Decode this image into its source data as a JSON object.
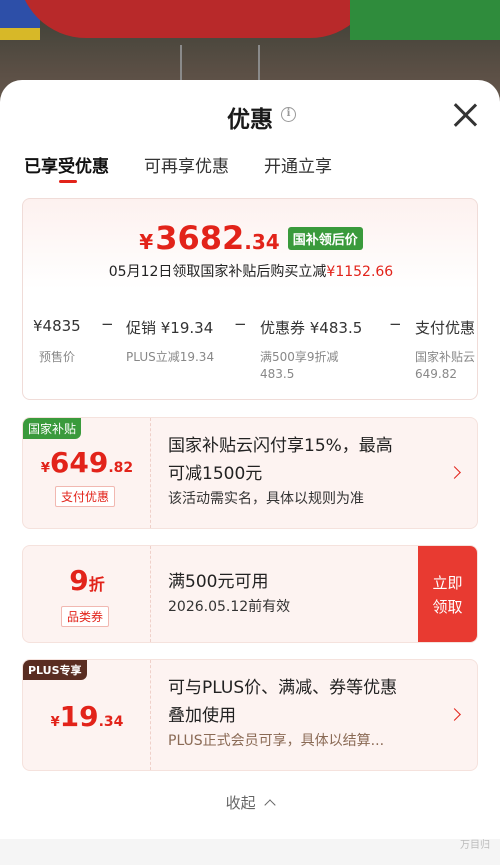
{
  "sheet": {
    "title": "优惠",
    "info_icon": "info-icon",
    "close_icon": "close-icon"
  },
  "tabs": [
    {
      "label": "已享受优惠",
      "active": true
    },
    {
      "label": "可再享优惠",
      "active": false
    },
    {
      "label": "开通立享",
      "active": false
    }
  ],
  "summary": {
    "currency": "¥",
    "price_int": "3682",
    "price_dec": ".34",
    "badge": "国补领后价",
    "line_prefix": "05月12日领取国家补贴后购买立减",
    "line_amount": "¥1152.66",
    "calc": [
      {
        "label": "¥4835",
        "sub": "预售价"
      },
      {
        "label": "促销 ¥19.34",
        "sub": "PLUS立减19.34"
      },
      {
        "label": "优惠券 ¥483.5",
        "sub": "满500享9折减",
        "sub2": "483.5"
      },
      {
        "label": "支付优惠",
        "sub": "国家补贴云",
        "sub2": "649.82"
      }
    ],
    "minus": "−"
  },
  "offers": [
    {
      "tag": "国家补贴",
      "currency": "¥",
      "amount_int": "649",
      "amount_dec": ".82",
      "pill": "支付优惠",
      "line1": "国家补贴云闪付享15%，最高",
      "line2": "可减1500元",
      "note": "该活动需实名，具体以规则为准"
    },
    {
      "amount_int": "9",
      "amount_unit": "折",
      "pill": "品类券",
      "line1": "满500元可用",
      "note": "2026.05.12前有效",
      "button_line1": "立即",
      "button_line2": "领取"
    },
    {
      "tag": "PLUS专享",
      "currency": "¥",
      "amount_int": "19",
      "amount_dec": ".34",
      "line1": "可与PLUS价、满减、券等优惠",
      "line2": "叠加使用",
      "note": "PLUS正式会员可享，具体以结算..."
    }
  ],
  "collapse_label": "收起",
  "watermark": "万目归",
  "colors": {
    "accent": "#e2231a",
    "green": "#3a9a3c",
    "plus_tag": "#5a2d22"
  }
}
